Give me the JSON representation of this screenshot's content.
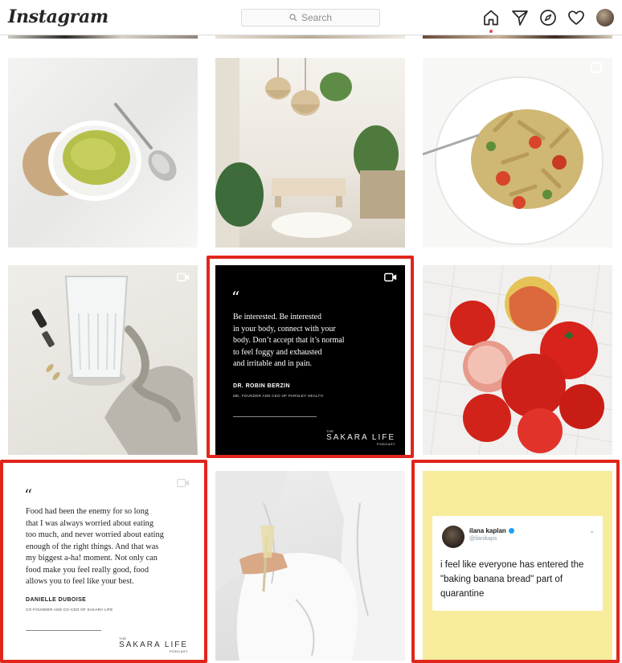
{
  "app": {
    "logo": "Instagram"
  },
  "header": {
    "search_placeholder": "Search"
  },
  "nav": [
    "home-icon",
    "direct-icon",
    "explore-icon",
    "activity-icon",
    "profile-avatar"
  ],
  "grid": {
    "quote_tile_1": {
      "mark": "“",
      "lines": [
        "Be interested. Be interested",
        "in your body, connect with your",
        "body. Don’t accept that it’s normal",
        "to feel foggy and exhausted",
        "and irritable and in pain."
      ],
      "author": "DR. ROBIN BERZIN",
      "role": "MD, FOUNDER AND CEO OF PARSLEY HEALTH",
      "brand_the": "THE",
      "brand_name": "SAKARA LIFE",
      "brand_podcast": "PODCAST"
    },
    "quote_tile_2": {
      "mark": "“",
      "lines": [
        "Food had been the enemy for so long",
        "that I was always worried about eating",
        "too much, and never worried about eating",
        "enough of the right things. And that was",
        "my biggest a-ha! moment. Not only can",
        "food make you feel really good, food",
        "allows you to feel like your best."
      ],
      "author": "DANIELLE DUBOISE",
      "role": "CO-FOUNDER AND CO-CEO OF SAKARA LIFE",
      "brand_the": "THE",
      "brand_name": "SAKARA LIFE",
      "brand_podcast": "PODCAST"
    },
    "tweet_tile": {
      "name": "ilana kaplan",
      "handle": "@ilanikaps",
      "text": "i feel like everyone has entered the \"baking banana bread\" part of quarantine"
    }
  },
  "colors": {
    "highlight": "#e0261c",
    "tweet_bg": "#f7ec9b",
    "verified": "#1da1f2",
    "home_dot": "#ed4956"
  }
}
